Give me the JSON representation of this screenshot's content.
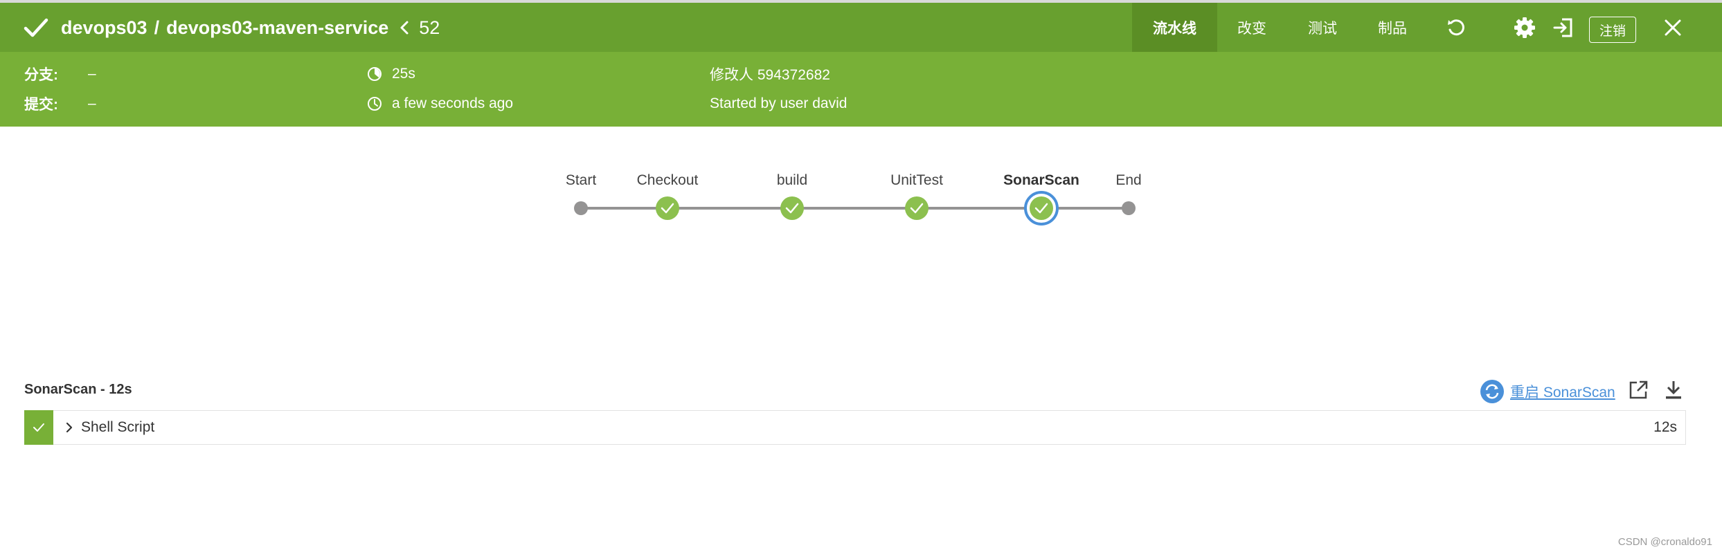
{
  "header": {
    "org": "devops03",
    "separator": "/",
    "project": "devops03-maven-service",
    "run_number": "52",
    "status_color": "#68a02f",
    "tabs": [
      {
        "label": "流水线",
        "active": true
      },
      {
        "label": "改变",
        "active": false
      },
      {
        "label": "测试",
        "active": false
      },
      {
        "label": "制品",
        "active": false
      }
    ],
    "icons": [
      "replay-icon",
      "gear-icon",
      "exit-icon",
      "close-icon"
    ],
    "logout_label": "注销"
  },
  "info": {
    "branch_label": "分支:",
    "branch_value": "–",
    "commit_label": "提交:",
    "commit_value": "–",
    "duration": "25s",
    "time_ago": "a few seconds ago",
    "changes": "修改人 594372682",
    "started_by": "Started by user david"
  },
  "pipeline": {
    "stages": [
      {
        "name": "Start",
        "kind": "terminal"
      },
      {
        "name": "Checkout",
        "kind": "success"
      },
      {
        "name": "build",
        "kind": "success"
      },
      {
        "name": "UnitTest",
        "kind": "success"
      },
      {
        "name": "SonarScan",
        "kind": "success",
        "selected": true
      },
      {
        "name": "End",
        "kind": "terminal"
      }
    ],
    "colors": {
      "success": "#8cc04f",
      "line": "#949393",
      "selected_ring": "#4a90d9"
    }
  },
  "step_detail": {
    "header": "SonarScan - 12s",
    "restart_label": "重启 SonarScan",
    "steps": [
      {
        "name": "Shell Script",
        "duration": "12s",
        "status": "success"
      }
    ]
  },
  "watermark": "CSDN @cronaldo91"
}
